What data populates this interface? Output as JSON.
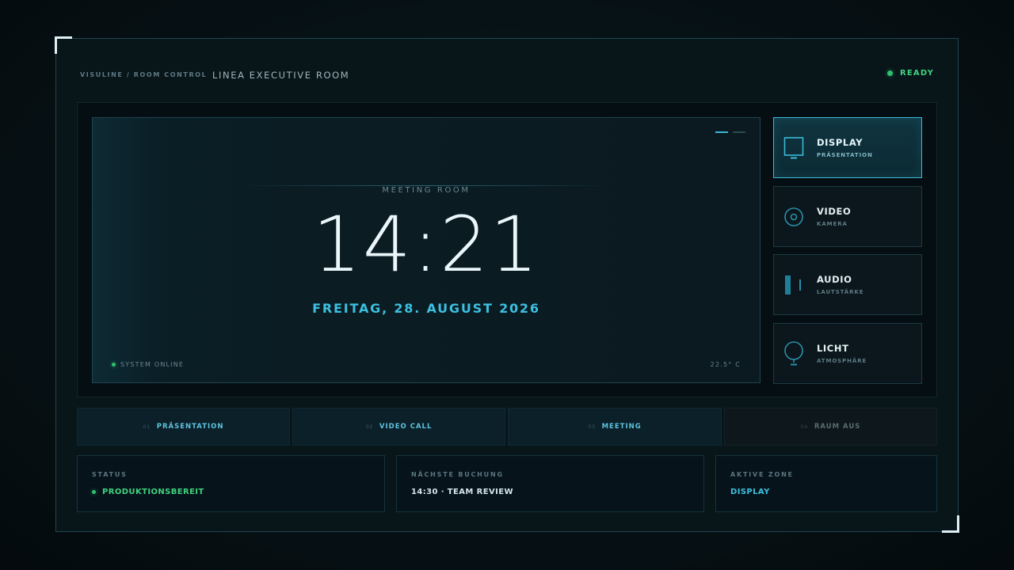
{
  "header": {
    "brand": "VISULINE / ROOM CONTROL",
    "room_name": "LINEA EXECUTIVE ROOM",
    "status": "READY"
  },
  "clock_panel": {
    "label": "MEETING ROOM",
    "time": "14:21",
    "date": "FREITAG, 28. AUGUST 2026",
    "system_status": "SYSTEM ONLINE",
    "temperature": "22.5° C",
    "pager_pages": 2,
    "pager_active": 1
  },
  "modes": [
    {
      "title": "DISPLAY",
      "subtitle": "PRÄSENTATION",
      "icon": "display-icon",
      "active": true
    },
    {
      "title": "VIDEO",
      "subtitle": "KAMERA",
      "icon": "camera-icon",
      "active": false
    },
    {
      "title": "AUDIO",
      "subtitle": "LAUTSTÄRKE",
      "icon": "volume-icon",
      "active": false
    },
    {
      "title": "LICHT",
      "subtitle": "ATMOSPHÄRE",
      "icon": "lightbulb-icon",
      "active": false
    }
  ],
  "presets": [
    {
      "num": "01",
      "label": "PRÄSENTATION"
    },
    {
      "num": "02",
      "label": "VIDEO CALL"
    },
    {
      "num": "03",
      "label": "MEETING"
    },
    {
      "num": "04",
      "label": "RAUM AUS"
    }
  ],
  "info": {
    "status": {
      "heading": "STATUS",
      "value": "PRODUKTIONSBEREIT"
    },
    "next_booking": {
      "heading": "NÄCHSTE BUCHUNG",
      "value": "14:30 · TEAM REVIEW"
    },
    "active_zone": {
      "heading": "AKTIVE ZONE",
      "value": "DISPLAY"
    }
  },
  "colors": {
    "accent": "#3ab9d6",
    "ready_green": "#3fd27f",
    "background": "#071216"
  }
}
